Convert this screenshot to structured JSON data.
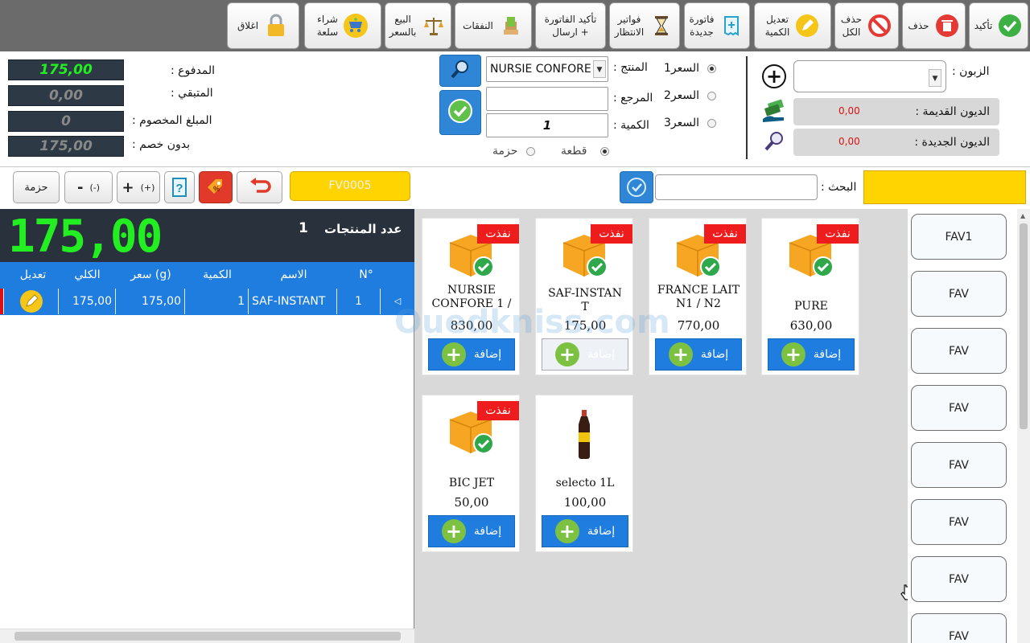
{
  "toolbar": {
    "confirm": "تأكيد",
    "delete": "حذف",
    "delete_all": "حذف\nالكل",
    "edit_qty": "تعديل\nالكمية",
    "new_invoice": "فاتورة\nجديدة",
    "pending": "فواتير\nالانتظار",
    "confirm_send": "تأكيد الفاتورة\n+ ارسال",
    "expenses": "النفقات",
    "sell_price": "البيع\nبالسعر",
    "buy": "شراء\nسلعة",
    "close": "اغلاق"
  },
  "payment": {
    "paid_label": "المدفوع :",
    "paid_value": "175,00",
    "remaining_label": "المتبقي :",
    "remaining_value": "0,00",
    "discount_label": "المبلغ المخصوم :",
    "discount_value": "0",
    "no_discount_label": "بدون خصم :",
    "no_discount_value": "175,00"
  },
  "product_form": {
    "product_label": "المنتج :",
    "product_value": "NURSIE CONFORE",
    "reference_label": "المرجع :",
    "reference_value": "",
    "quantity_label": "الكمية :",
    "quantity_value": "1",
    "price1": "السعر1",
    "price2": "السعر2",
    "price3": "السعر3",
    "unit_piece": "قطعة",
    "unit_pack": "حزمة"
  },
  "customer": {
    "label": "الزبون :",
    "old_debt_label": "الديون القديمة :",
    "old_debt_value": "0,00",
    "new_debt_label": "الديون الجديدة :",
    "new_debt_value": "0,00"
  },
  "search_row": {
    "pack_button": "حزمة",
    "minus_label": "-",
    "minus_hint": "(-)",
    "plus_label": "+",
    "plus_hint": "(+)",
    "invoice_number": "FV0005",
    "search_label": "البحث :"
  },
  "cart": {
    "total": "175,00",
    "product_count_label": "عدد المنتجات",
    "product_count": "1",
    "columns": [
      "N°",
      "الاسم",
      "الكمية",
      "سعر (g)",
      "الكلي",
      "تعديل"
    ],
    "rows": [
      {
        "n": "1",
        "name": "SAF-INSTANT",
        "qty": "1",
        "price": "175,00",
        "total": "175,00"
      }
    ]
  },
  "products": [
    {
      "name": "PURE",
      "price": "630,00",
      "badge": "نفذت",
      "add": "إضافة"
    },
    {
      "name": "FRANCE LAIT N1 / N2",
      "price": "770,00",
      "badge": "نفذت",
      "add": "إضافة"
    },
    {
      "name": "SAF-INSTAN T",
      "price": "175,00",
      "badge": "نفذت",
      "add": "إضافة"
    },
    {
      "name": "NURSIE CONFORE 1 /",
      "price": "830,00",
      "badge": "نفذت",
      "add": "إضافة"
    },
    {
      "name": "selecto 1L",
      "price": "100,00",
      "add": "إضافة"
    },
    {
      "name": "BIC JET",
      "price": "50,00",
      "badge": "نفذت",
      "add": "إضافة"
    }
  ],
  "favorites": [
    "FAV1",
    "FAV",
    "FAV",
    "FAV",
    "FAV",
    "FAV",
    "FAV",
    "FAV"
  ],
  "watermark": "Ouedkniss.com"
}
